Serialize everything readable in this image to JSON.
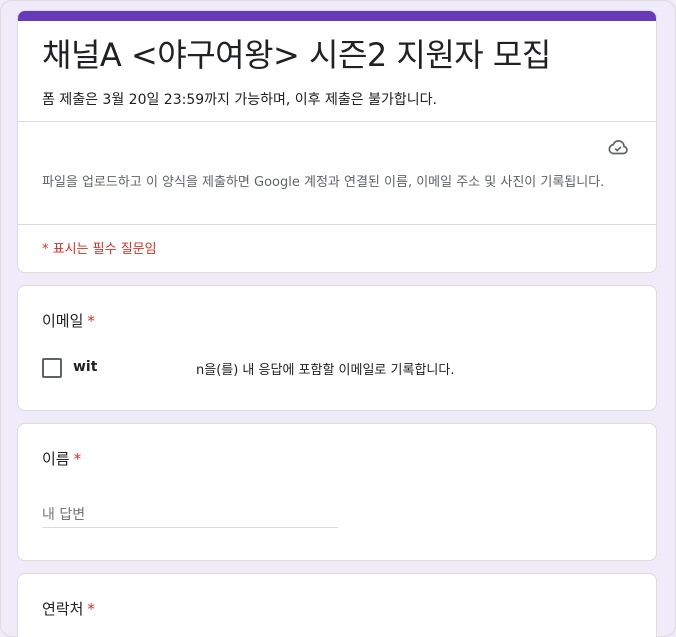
{
  "form": {
    "title": "채널A <야구여왕> 시즌2 지원자 모집",
    "description": "폼 제출은 3월 20일 23:59까지 가능하며, 이후 제출은 불가합니다.",
    "account_note": "파일을 업로드하고 이 양식을 제출하면 Google 계정과 연결된 이름, 이메일 주소 및 사진이 기록됩니다.",
    "required_note": "* 표시는 필수 질문임",
    "accent_color": "#673ab7",
    "status_icon": "cloud-check-icon"
  },
  "questions": {
    "email": {
      "title": "이메일",
      "required_mark": "*",
      "email_value": "witl",
      "consent_text": "n을(를) 내 응답에 포함할 이메일로 기록합니다.",
      "checked": false
    },
    "name": {
      "title": "이름",
      "required_mark": "*",
      "placeholder": "내 답변"
    },
    "phone": {
      "title": "연락처",
      "required_mark": "*"
    }
  }
}
